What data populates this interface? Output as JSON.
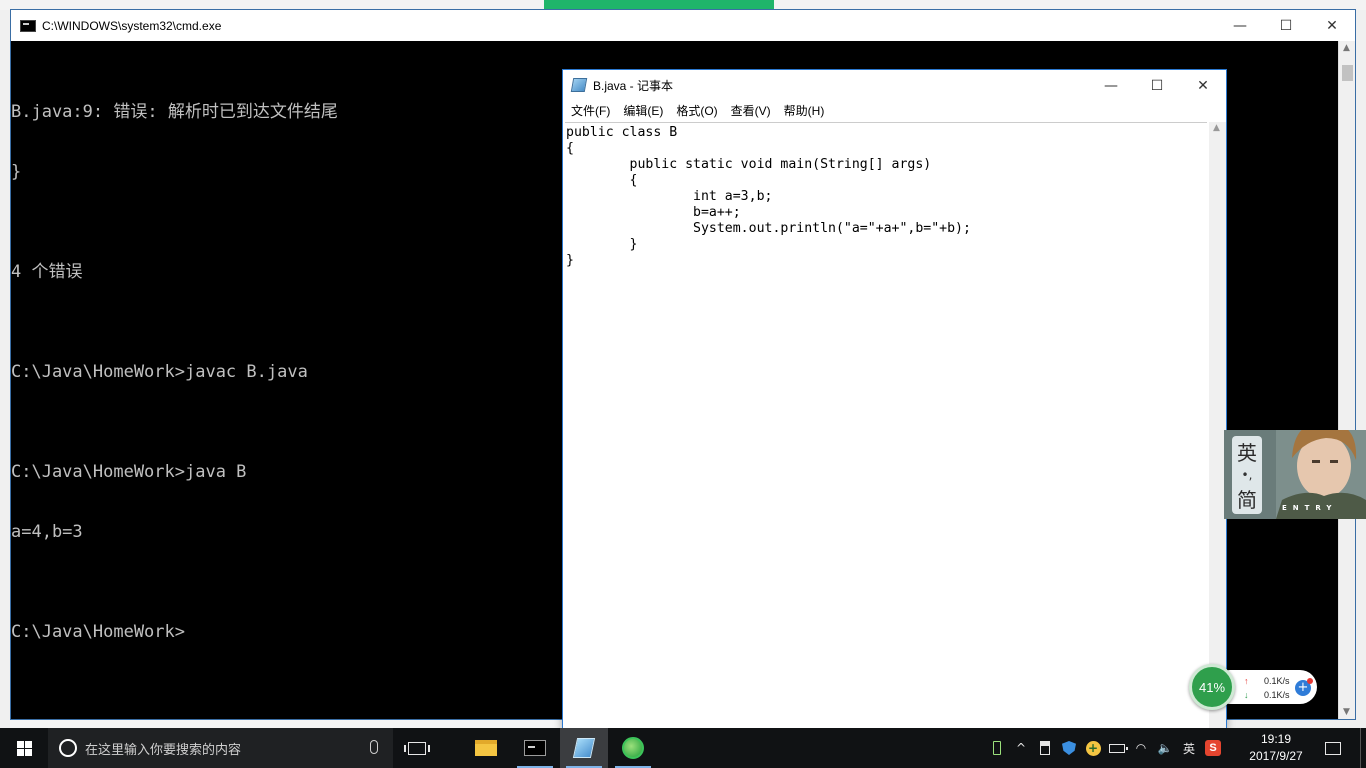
{
  "cmd_window": {
    "title": "C:\\WINDOWS\\system32\\cmd.exe",
    "lines": [
      "B.java:9: 错误: 解析时已到达文件结尾",
      "}",
      "",
      "4 个错误",
      "",
      "C:\\Java\\HomeWork>javac B.java",
      "",
      "C:\\Java\\HomeWork>java B",
      "a=4,b=3",
      "",
      "C:\\Java\\HomeWork>"
    ]
  },
  "notepad_window": {
    "title": "B.java - 记事本",
    "menu": [
      "文件(F)",
      "编辑(E)",
      "格式(O)",
      "查看(V)",
      "帮助(H)"
    ],
    "content": "public class B\n{\n\tpublic static void main(String[] args)\n\t{\n\t\tint a=3,b;\n\t\tb=a++;\n\t\tSystem.out.println(\"a=\"+a+\",b=\"+b);\n\t}\n}"
  },
  "window_controls": {
    "minimize": "—",
    "maximize": "☐",
    "close": "✕"
  },
  "ime_widget": {
    "lang_primary": "英",
    "lang_dot": "•,",
    "lang_secondary": "简"
  },
  "speed_widget": {
    "percent": "41%",
    "upload": "0.1K/s",
    "download": "0.1K/s",
    "up_arrow": "↑",
    "down_arrow": "↓",
    "plus": "+"
  },
  "taskbar": {
    "search_placeholder": "在这里输入你要搜索的内容",
    "ime_tray_label": "英",
    "tray_chevron": "^",
    "sogou_label": "S",
    "clock_time": "19:19",
    "clock_date": "2017/9/27",
    "icons": {
      "start": "windows-logo-icon",
      "search": "cortana-circle-icon",
      "mic": "microphone-icon",
      "task_view": "task-view-icon",
      "explorer": "folder-icon",
      "cmd": "cmd-icon",
      "notepad": "notepad-icon",
      "browser": "browser-icon",
      "notifications": "notification-icon"
    }
  },
  "colors": {
    "cmd_bg": "#000000",
    "cmd_text": "#c0c0c0",
    "notepad_border": "#2b79d1",
    "taskbar_bg": "#101214",
    "browser_active_tab": "#1fb56a"
  }
}
